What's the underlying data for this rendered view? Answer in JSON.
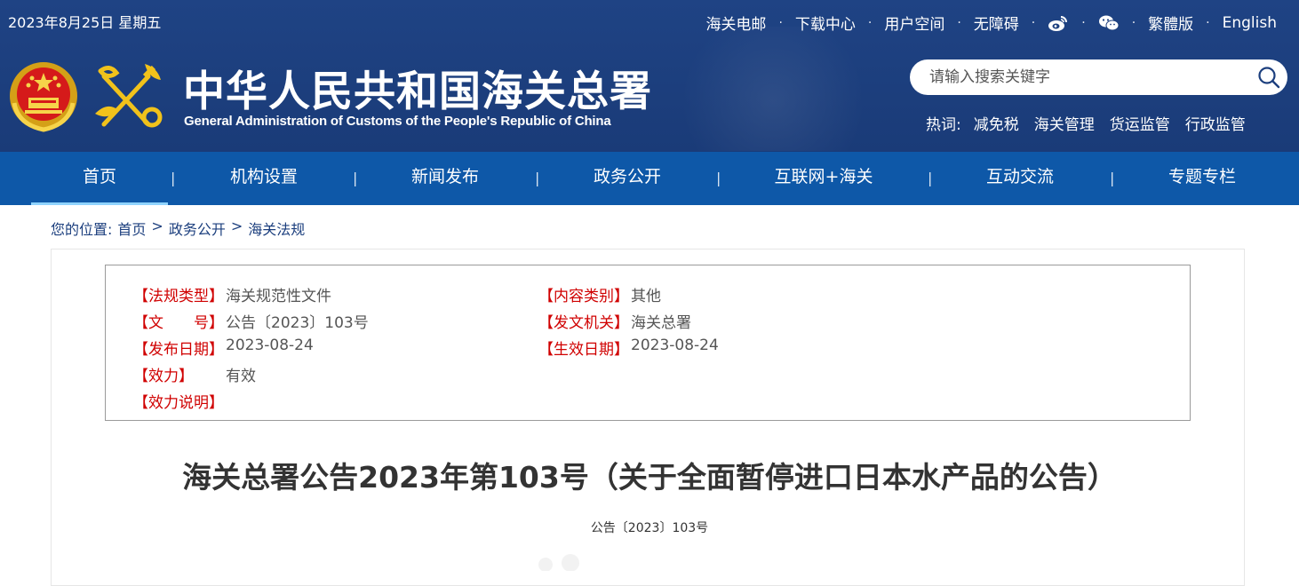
{
  "header": {
    "date": "2023年8月25日 星期五",
    "top_links": [
      "海关电邮",
      "下载中心",
      "用户空间",
      "无障碍"
    ],
    "lang_traditional": "繁體版",
    "lang_english": "English",
    "title_cn": "中华人民共和国海关总署",
    "title_en": "General Administration of Customs of the People's Republic of China",
    "icons": [
      "weibo-icon",
      "wechat-icon",
      "search-icon"
    ]
  },
  "search": {
    "placeholder": "请输入搜索关键字"
  },
  "hot": {
    "label": "热词:",
    "keywords": [
      "减免税",
      "海关管理",
      "货运监管",
      "行政监管"
    ]
  },
  "nav": {
    "items": [
      "首页",
      "机构设置",
      "新闻发布",
      "政务公开",
      "互联网+海关",
      "互动交流",
      "专题专栏"
    ],
    "active": "首页"
  },
  "breadcrumb": {
    "prefix": "您的位置:",
    "items": [
      "首页",
      "政务公开",
      "海关法规"
    ],
    "separator": ">"
  },
  "info": {
    "left": [
      {
        "key": "【法规类型】",
        "value": "海关规范性文件"
      },
      {
        "key": "【文　　号】",
        "value": "公告〔2023〕103号"
      },
      {
        "key": "【发布日期】",
        "value": "2023-08-24"
      },
      {
        "key": "【效力】",
        "value": "有效"
      },
      {
        "key": "【效力说明】",
        "value": ""
      }
    ],
    "right": [
      {
        "key": "【内容类别】",
        "value": "其他"
      },
      {
        "key": "【发文机关】",
        "value": "海关总署"
      },
      {
        "key": "【生效日期】",
        "value": "2023-08-24"
      }
    ]
  },
  "document": {
    "title": "海关总署公告2023年第103号（关于全面暂停进口日本水产品的公告）",
    "number": "公告〔2023〕103号"
  },
  "colors": {
    "header_bg": "#1c3f7e",
    "nav_bg": "#0e58a8",
    "label_red": "#d00000"
  }
}
